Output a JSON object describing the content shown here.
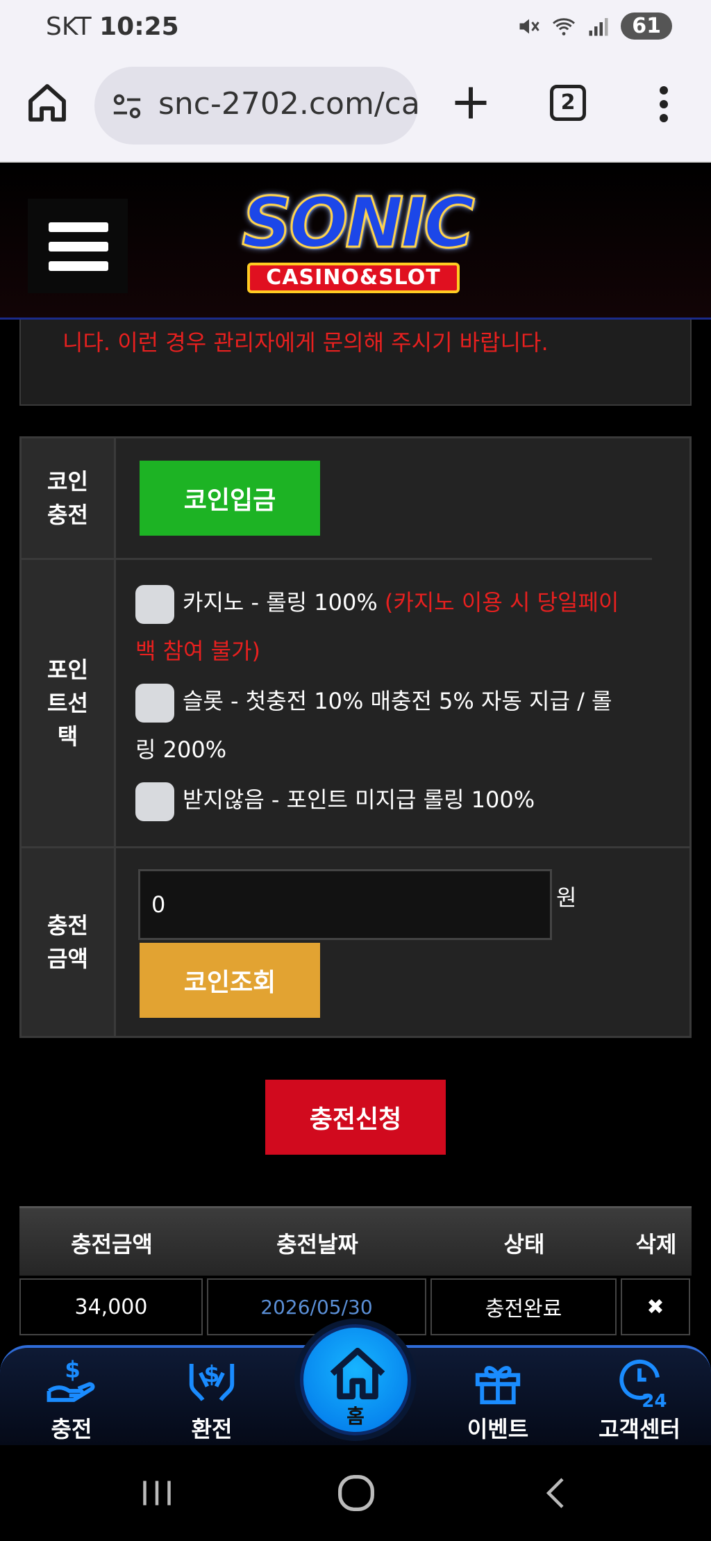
{
  "status_bar": {
    "carrier": "SKT",
    "time": "10:25",
    "battery": "61"
  },
  "browser": {
    "url": "snc-2702.com/ca",
    "tab_count": "2"
  },
  "site": {
    "logo_main": "SONIC",
    "logo_sub": "CASINO&SLOT"
  },
  "notice": {
    "text": "니다. 이런 경우 관리자에게 문의해 주시기 바랍니다."
  },
  "form": {
    "coin": {
      "label_line1": "코인",
      "label_line2": "충전",
      "button": "코인입금"
    },
    "point": {
      "label_line1": "포인",
      "label_line2": "트선",
      "label_line3": "택",
      "options": [
        {
          "text": "카지노 - 롤링 100% ",
          "note_part1": "(카지노 이용 시 당일페이",
          "note_part2": "백 참여 불가)"
        },
        {
          "text_part1": "슬롯 - 첫충전 10% 매충전 5% 자동 지급 / 롤",
          "text_part2": "링 200%"
        },
        {
          "text": "받지않음 - 포인트 미지급 롤링 100%"
        }
      ]
    },
    "amount": {
      "label_line1": "충전",
      "label_line2": "금액",
      "value": "0",
      "unit": "원",
      "button": "코인조회"
    }
  },
  "submit_button": "충전신청",
  "history": {
    "headers": [
      "충전금액",
      "충전날짜",
      "상태",
      "삭제"
    ],
    "rows": [
      {
        "amount": "34,000",
        "date": "2026/05/30",
        "status": "충전완료",
        "delete": "✖"
      }
    ]
  },
  "bottom_nav": {
    "items": [
      {
        "label": "충전",
        "icon": "deposit-icon"
      },
      {
        "label": "환전",
        "icon": "withdraw-icon"
      },
      {
        "label": "홈",
        "icon": "home-icon"
      },
      {
        "label": "이벤트",
        "icon": "gift-icon"
      },
      {
        "label": "고객센터",
        "icon": "support-24-icon"
      }
    ],
    "accent": "#1a8cff"
  }
}
